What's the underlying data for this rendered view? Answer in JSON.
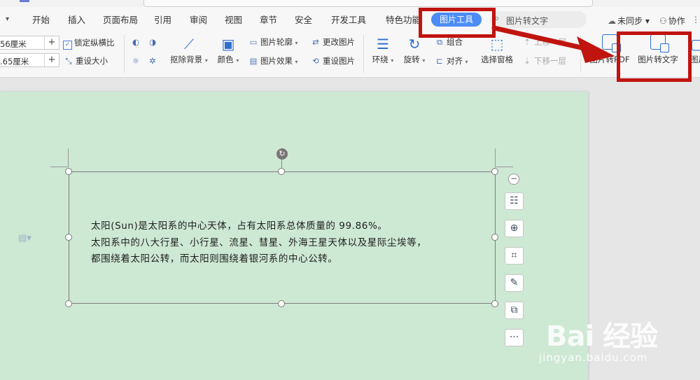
{
  "menu": {
    "caret": "▾",
    "tabs": [
      {
        "label": "开始"
      },
      {
        "label": "插入"
      },
      {
        "label": "页面布局"
      },
      {
        "label": "引用"
      },
      {
        "label": "审阅"
      },
      {
        "label": "视图"
      },
      {
        "label": "章节"
      },
      {
        "label": "安全"
      },
      {
        "label": "开发工具"
      },
      {
        "label": "特色功能"
      },
      {
        "label": "图片工具",
        "active": true
      }
    ],
    "search_placeholder": "图片转文字",
    "sync_label": "未同步",
    "collab_label": "协作",
    "more": "⋮"
  },
  "ribbon": {
    "height_value": "56厘米",
    "width_value": ".65厘米",
    "plus": "+",
    "lock_ratio": "锁定纵横比",
    "reset_size": "重设大小",
    "remove_bg": "抠除背景",
    "color": "颜色",
    "pic_outline": "图片轮廓",
    "pic_effect": "图片效果",
    "change_pic": "更改图片",
    "reset_pic": "重设图片",
    "wrap": "环绕",
    "rotate": "旋转",
    "group": "组合",
    "align": "对齐",
    "selection_pane": "选择窗格",
    "bring_forward": "上移一层",
    "send_backward": "下移一层",
    "to_pdf": "图片转PDF",
    "to_text": "图片转文字",
    "print_pic": "图片"
  },
  "document": {
    "lines": [
      "太阳(Sun)是太阳系的中心天体，占有太阳系总体质量的 99.86%。",
      "太阳系中的八大行星、小行星、流星、彗星、外海王星天体以及星际尘埃等，",
      "都围绕着太阳公转，而太阳则围绕着银河系的中心公转。"
    ]
  },
  "side_toolbar": {
    "more": "···"
  },
  "watermark": {
    "logo": "Bai 经验",
    "url": "jingyan.baidu.com"
  },
  "colors": {
    "accent": "#4c8cf5",
    "annotation_red": "#c0140f",
    "page_bg": "#cde8d3"
  }
}
